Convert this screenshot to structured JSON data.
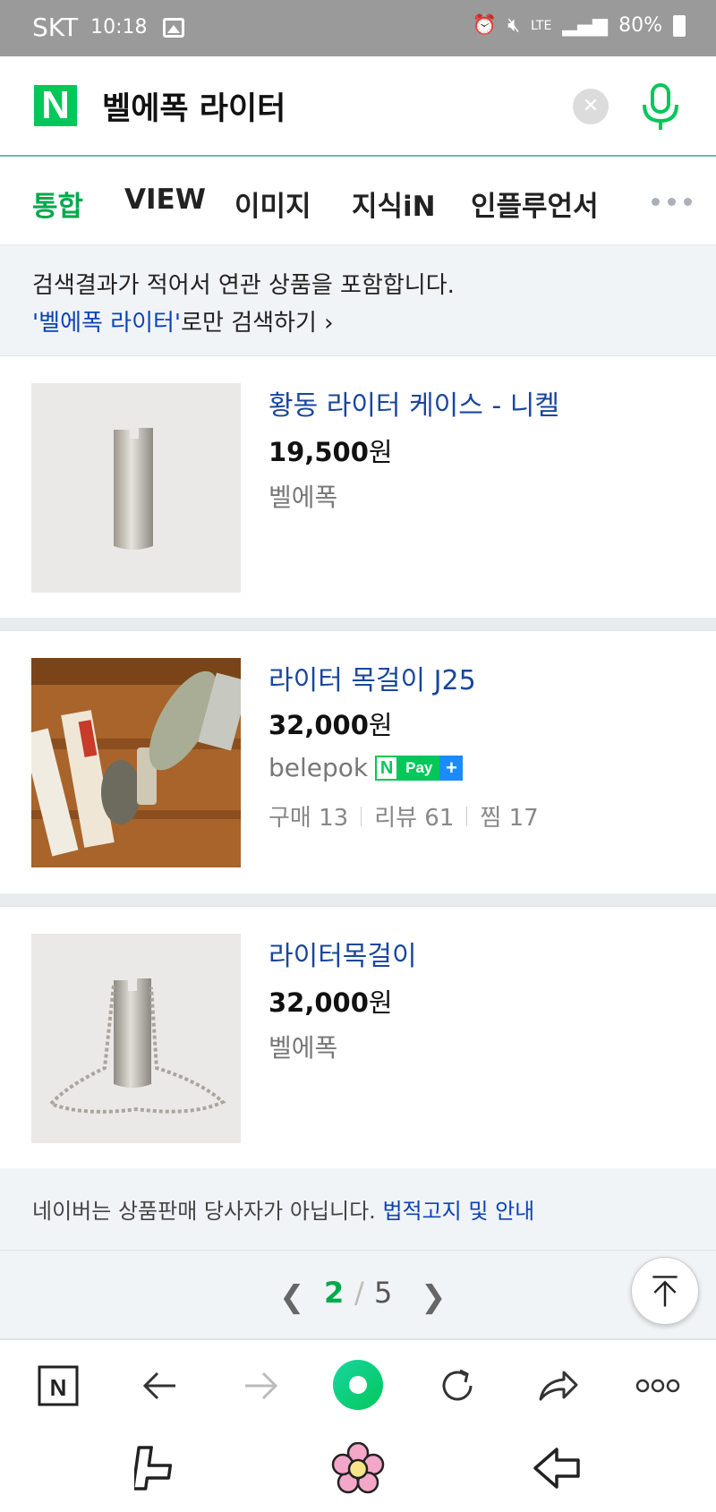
{
  "status_bar": {
    "carrier": "SKT",
    "time": "10:18",
    "network": "LTE",
    "battery": "80%"
  },
  "search": {
    "query": "벨에폭 라이터",
    "logo": "N"
  },
  "tabs": [
    {
      "label": "통합",
      "active": true
    },
    {
      "label": "VIEW",
      "active": false
    },
    {
      "label": "이미지",
      "active": false
    },
    {
      "label": "지식iN",
      "active": false
    },
    {
      "label": "인플루언서",
      "active": false
    }
  ],
  "notice": {
    "line1": "검색결과가 적어서 연관 상품을 포함합니다.",
    "link_text": "'벨에폭 라이터'",
    "link_suffix": "로만 검색하기 ›"
  },
  "products": [
    {
      "title": "황동 라이터 케이스 - 니켈",
      "price": "19,500",
      "currency": "원",
      "seller": "벨에폭"
    },
    {
      "title": "라이터 목걸이 J25",
      "price": "32,000",
      "currency": "원",
      "seller": "belepok",
      "npay": {
        "n": "N",
        "pay": "Pay",
        "plus": "+"
      },
      "stats": [
        "구매 13",
        "리뷰 61",
        "찜 17"
      ]
    },
    {
      "title": "라이터목걸이",
      "price": "32,000",
      "currency": "원",
      "seller": "벨에폭"
    }
  ],
  "disclaimer": {
    "text": "네이버는 상품판매 당사자가 아닙니다. ",
    "link": "법적고지 및 안내"
  },
  "pagination": {
    "current": "2",
    "separator": "/",
    "total": "5"
  },
  "colors": {
    "naver_green": "#03c75a",
    "link_blue": "#18479c",
    "status_gray": "#9a9a9a"
  }
}
